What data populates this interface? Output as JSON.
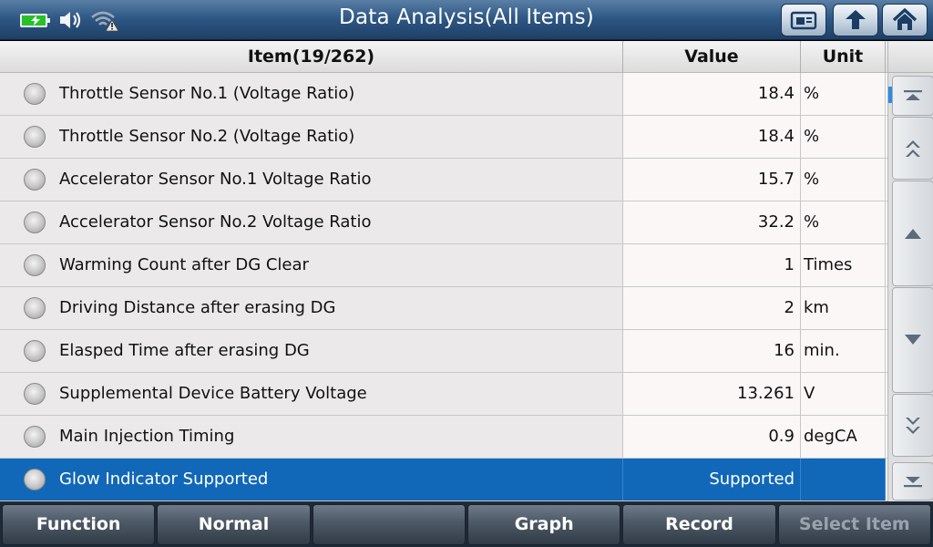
{
  "header": {
    "title": "Data Analysis(All Items)",
    "icons": [
      "battery-charging-icon",
      "speaker-icon",
      "wifi-warning-icon",
      "screenshot-icon",
      "back-icon",
      "home-icon"
    ]
  },
  "table": {
    "headers": {
      "item": "Item(19/262)",
      "value": "Value",
      "unit": "Unit"
    },
    "rows": [
      {
        "item": "Throttle Sensor No.1 (Voltage Ratio)",
        "value": "18.4",
        "unit": "%"
      },
      {
        "item": "Throttle Sensor No.2 (Voltage Ratio)",
        "value": "18.4",
        "unit": "%"
      },
      {
        "item": "Accelerator Sensor No.1 Voltage Ratio",
        "value": "15.7",
        "unit": "%"
      },
      {
        "item": "Accelerator Sensor No.2 Voltage Ratio",
        "value": "32.2",
        "unit": "%"
      },
      {
        "item": "Warming Count after DG Clear",
        "value": "1",
        "unit": "Times"
      },
      {
        "item": "Driving Distance after erasing DG",
        "value": "2",
        "unit": "km"
      },
      {
        "item": "Elasped Time after erasing DG",
        "value": "16",
        "unit": "min."
      },
      {
        "item": "Supplemental Device Battery Voltage",
        "value": "13.261",
        "unit": "V"
      },
      {
        "item": "Main Injection Timing",
        "value": "0.9",
        "unit": "degCA"
      },
      {
        "item": "Glow Indicator Supported",
        "value": "Supported",
        "unit": ""
      }
    ],
    "selected_row": 9
  },
  "footer": {
    "buttons": [
      "Function",
      "Normal",
      "",
      "Graph",
      "Record",
      "Select Item"
    ]
  },
  "colors": {
    "header_bg": "#2f5885",
    "selected_row": "#1168b8",
    "battery": "#27c127"
  }
}
